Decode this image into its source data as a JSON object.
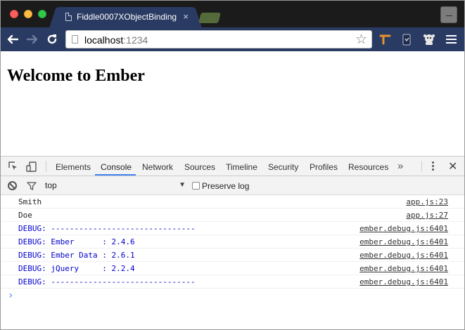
{
  "browser": {
    "tab": {
      "title": "Fiddle0007XObjectBinding",
      "close_glyph": "×",
      "icon": "document-icon"
    },
    "url": {
      "host": "localhost",
      "port": ":1234"
    },
    "icons": {
      "back": "arrow-left-icon",
      "forward": "arrow-right-icon",
      "reload": "reload-icon",
      "bookmark": "star-icon",
      "menu": "hamburger-menu-icon"
    },
    "glyphs": {
      "back": "🡐",
      "forward": "🡒",
      "reload": "↻",
      "star": "☆"
    },
    "colors": {
      "titlebar": "#1b1b1b",
      "toolbar": "#2a3b63"
    }
  },
  "page": {
    "heading": "Welcome to Ember"
  },
  "devtools": {
    "tabs": [
      {
        "label": "Elements"
      },
      {
        "label": "Console",
        "active": true
      },
      {
        "label": "Network"
      },
      {
        "label": "Sources"
      },
      {
        "label": "Timeline"
      },
      {
        "label": "Security"
      },
      {
        "label": "Profiles"
      },
      {
        "label": "Resources"
      }
    ],
    "more_glyph": "»",
    "close_glyph": "✕",
    "console_toolbar": {
      "context": "top",
      "dropdown_glyph": "▼",
      "preserve_log_label": "Preserve log",
      "preserve_log_checked": false
    },
    "messages": [
      {
        "text": "Smith",
        "source": "app.js:23",
        "level": "log"
      },
      {
        "text": "Doe",
        "source": "app.js:27",
        "level": "log"
      },
      {
        "text": "DEBUG: -------------------------------",
        "source": "ember.debug.js:6401",
        "level": "debug"
      },
      {
        "text": "DEBUG: Ember      : 2.4.6",
        "source": "ember.debug.js:6401",
        "level": "debug"
      },
      {
        "text": "DEBUG: Ember Data : 2.6.1",
        "source": "ember.debug.js:6401",
        "level": "debug"
      },
      {
        "text": "DEBUG: jQuery     : 2.2.4",
        "source": "ember.debug.js:6401",
        "level": "debug"
      },
      {
        "text": "DEBUG: -------------------------------",
        "source": "ember.debug.js:6401",
        "level": "debug"
      }
    ],
    "prompt_glyph": "›",
    "colors": {
      "active_tab_underline": "#4285f4",
      "debug_text": "#0000cc"
    }
  }
}
